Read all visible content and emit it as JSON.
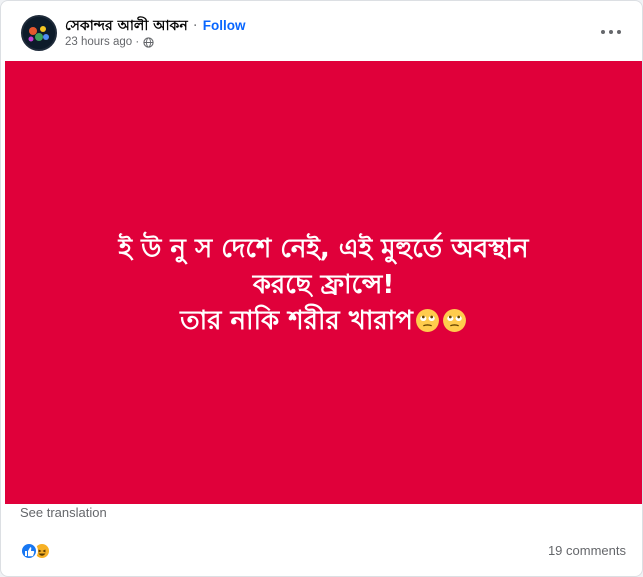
{
  "post": {
    "author": "সেকান্দর আলী আকন",
    "separator": "·",
    "follow_label": "Follow",
    "time": "23 hours ago",
    "meta_separator": "·",
    "privacy_icon": "globe-icon",
    "more_icon": "more-dots-icon"
  },
  "banner": {
    "background": "#e0003a",
    "text_color": "#ffffff",
    "line1": "ই উ নু স দেশে নেই, এই মুহুর্তে অবস্থান",
    "line2": "করছে ফ্রান্সে!",
    "line3": "তার নাকি শরীর খারাপ",
    "emojis": [
      "eye-roll-emoji",
      "eye-roll-emoji"
    ]
  },
  "footer": {
    "see_translation": "See translation",
    "reaction_icons": [
      "like-reaction-icon",
      "haha-reaction-icon"
    ],
    "comments": "19 comments"
  },
  "colors": {
    "accent": "#0866ff",
    "muted": "#65676b",
    "like": "#1877f2",
    "haha": "#f7b125"
  }
}
